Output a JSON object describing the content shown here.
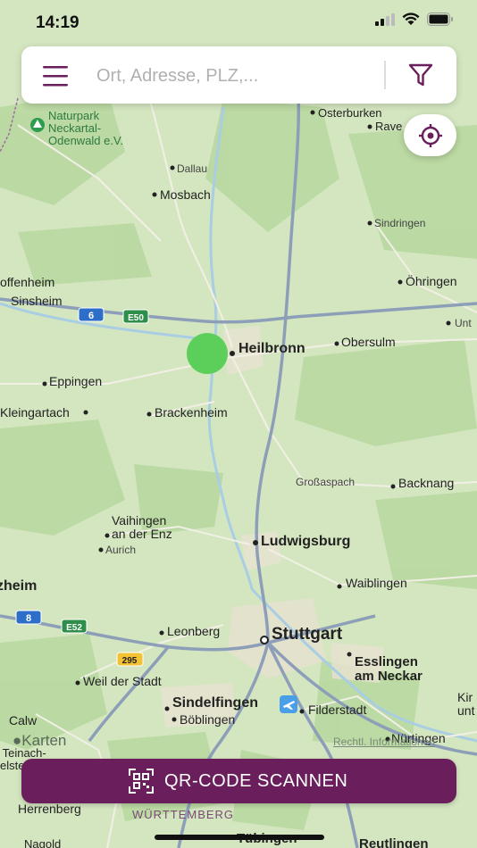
{
  "status_bar": {
    "time": "14:19"
  },
  "search": {
    "placeholder": "Ort, Adresse, PLZ,..."
  },
  "icons": {
    "menu": "hamburger-icon",
    "filter": "filter-funnel-icon",
    "locate": "crosshair-icon",
    "qr": "qr-code-icon",
    "nature_park": "park-icon",
    "airport": "airplane-icon"
  },
  "colors": {
    "accent": "#6a1f5c",
    "charging_point": "#5ccf5a"
  },
  "qr_button": {
    "label": "QR-CODE SCANNEN"
  },
  "attribution": {
    "maps_brand": "Karten",
    "legal": "Rechtl. Informationen"
  },
  "map": {
    "places": {
      "osterburken": "Osterburken",
      "rave": "Rave",
      "naturpark": "Naturpark\nNeckartal-\nOdenwald e.V.",
      "dallau": "Dallau",
      "mosbach": "Mosbach",
      "sindringen": "Sindringen",
      "ohringen": "Öhringen",
      "offenheim": "offenheim",
      "sinsheim": "Sinsheim",
      "unt": "Unt",
      "heilbronn": "Heilbronn",
      "obersulm": "Obersulm",
      "eppingen": "Eppingen",
      "kleingartach": "Kleingartach",
      "brackenheim": "Brackenheim",
      "grossaspach": "Großaspach",
      "backnang": "Backnang",
      "vaihingen1": "Vaihingen",
      "vaihingen2": "an der Enz",
      "aurich": "Aurich",
      "ludwigsburg": "Ludwigsburg",
      "heim": "zheim",
      "waiblingen": "Waiblingen",
      "leonberg": "Leonberg",
      "stuttgart": "Stuttgart",
      "esslingen1": "Esslingen",
      "esslingen2": "am Neckar",
      "weil": "Weil der Stadt",
      "sindelfingen": "Sindelfingen",
      "filderstadt": "Filderstadt",
      "boblingen": "Böblingen",
      "kir1": "Kir",
      "kir2": "unt",
      "calw": "Calw",
      "teinach1": "d Teinach-",
      "teinach2": "elstein",
      "nurtingen": "Nürtingen",
      "herrenberg": "Herrenberg",
      "wurttemberg": "WÜRTTEMBERG",
      "tubingen": "Tübingen",
      "reutlingen": "Reutlingen",
      "nagold": "Nagold"
    },
    "shields": {
      "a6": "6",
      "e50": "E50",
      "a8": "8",
      "e52": "E52",
      "b295": "295"
    }
  }
}
